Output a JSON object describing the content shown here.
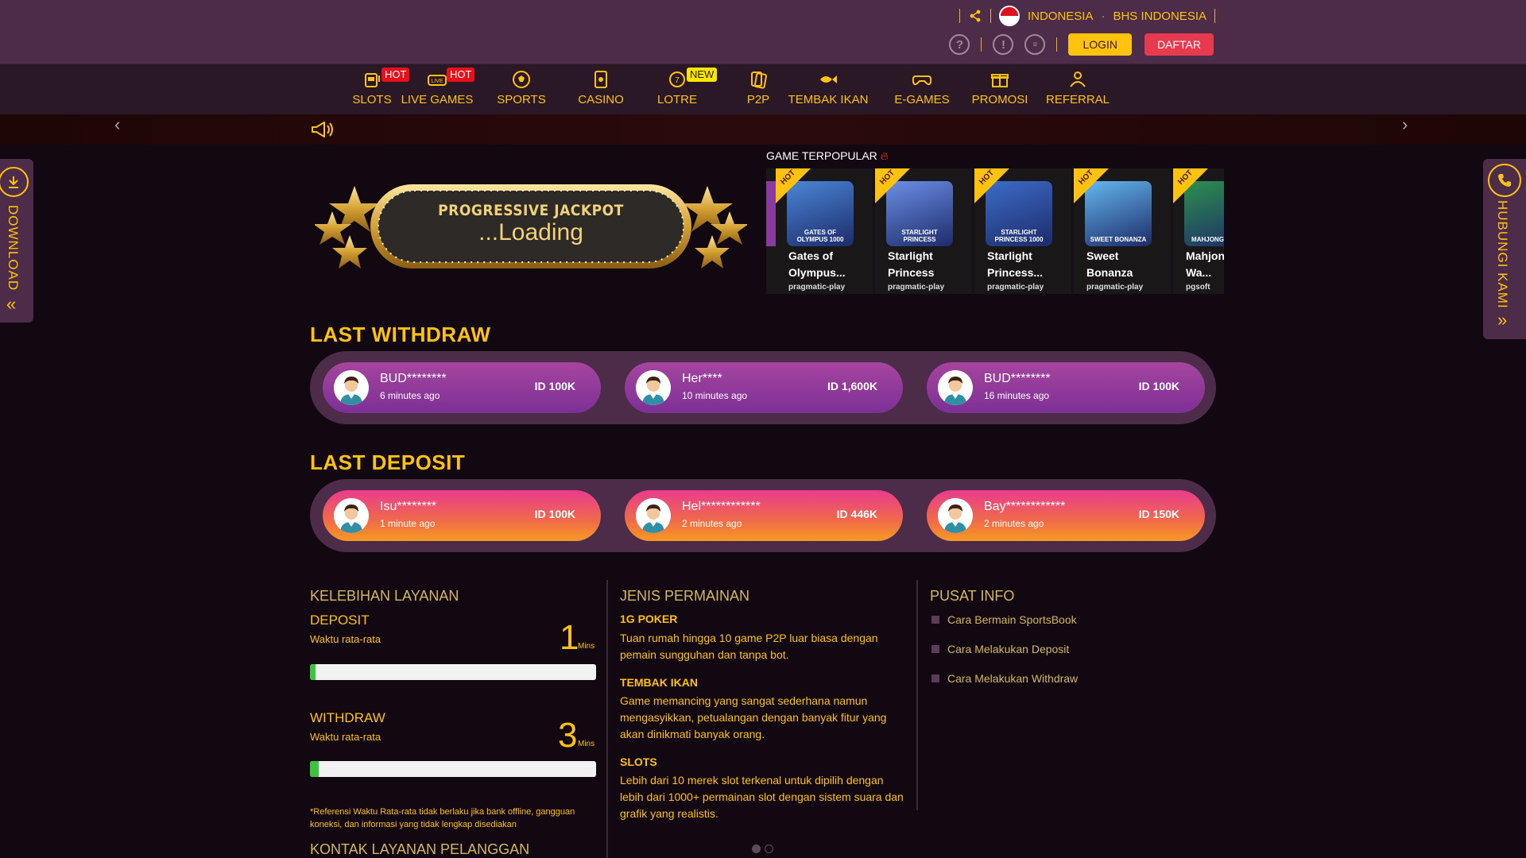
{
  "header": {
    "country": "INDONESIA",
    "language": "BHS INDONESIA",
    "login_label": "LOGIN",
    "register_label": "DAFTAR",
    "help_icon": "?",
    "info_icon": "!"
  },
  "nav": {
    "items": [
      {
        "label": "SLOTS",
        "icon": "slot-machine-icon",
        "badge": "HOT"
      },
      {
        "label": "LIVE GAMES",
        "icon": "live-icon",
        "badge": "HOT"
      },
      {
        "label": "SPORTS",
        "icon": "soccer-ball-icon",
        "badge": ""
      },
      {
        "label": "CASINO",
        "icon": "cards-icon",
        "badge": ""
      },
      {
        "label": "LOTRE",
        "icon": "lottery-icon",
        "badge": "NEW"
      },
      {
        "label": "P2P",
        "icon": "playing-cards-icon",
        "badge": ""
      },
      {
        "label": "TEMBAK IKAN",
        "icon": "fish-icon",
        "badge": ""
      },
      {
        "label": "E-GAMES",
        "icon": "gamepad-icon",
        "badge": ""
      },
      {
        "label": "PROMOSI",
        "icon": "gift-icon",
        "badge": ""
      },
      {
        "label": "REFERRAL",
        "icon": "referral-icon",
        "badge": ""
      }
    ]
  },
  "side": {
    "download_label": "DOWNLOAD",
    "contact_label": "HUBUNGI KAMI"
  },
  "jackpot": {
    "title": "PROGRESSIVE JACKPOT",
    "value": "...Loading"
  },
  "popular": {
    "title": "GAME TERPOPULAR",
    "hot_label": "HOT",
    "games": [
      {
        "name": "Gates of Olympus...",
        "provider": "pragmatic-play",
        "thumb_text": "GATES OF OLYMPUS 1000",
        "color": "#4a86d6"
      },
      {
        "name": "Starlight Princess",
        "provider": "pragmatic-play",
        "thumb_text": "STARLIGHT PRINCESS",
        "color": "#6b8fe6"
      },
      {
        "name": "Starlight Princess...",
        "provider": "pragmatic-play",
        "thumb_text": "STARLIGHT PRINCESS 1000",
        "color": "#3c6cc8"
      },
      {
        "name": "Sweet Bonanza",
        "provider": "pragmatic-play",
        "thumb_text": "SWEET BONANZA",
        "color": "#63b7ee"
      },
      {
        "name": "Mahjong Wa...",
        "provider": "pgsoft",
        "thumb_text": "MAHJONG WAYS",
        "color": "#2d8f4e"
      }
    ]
  },
  "withdraw": {
    "title": "LAST WITHDRAW",
    "items": [
      {
        "name": "BUD********",
        "time": "6 minutes ago",
        "amount": "ID 100K"
      },
      {
        "name": "Her****",
        "time": "10 minutes ago",
        "amount": "ID 1,600K"
      },
      {
        "name": "BUD********",
        "time": "16 minutes ago",
        "amount": "ID 100K"
      }
    ]
  },
  "deposit": {
    "title": "LAST DEPOSIT",
    "items": [
      {
        "name": "Isu********",
        "time": "1 minute ago",
        "amount": "ID 100K"
      },
      {
        "name": "Hel************",
        "time": "2 minutes ago",
        "amount": "ID 446K"
      },
      {
        "name": "Bay************",
        "time": "2 minutes ago",
        "amount": "ID 150K"
      }
    ]
  },
  "service": {
    "title": "KELEBIHAN LAYANAN",
    "deposit_label": "DEPOSIT",
    "deposit_sub": "Waktu rata-rata",
    "deposit_value": "1",
    "deposit_unit": "Mins",
    "deposit_progress": 0.02,
    "withdraw_label": "WITHDRAW",
    "withdraw_sub": "Waktu rata-rata",
    "withdraw_value": "3",
    "withdraw_unit": "Mins",
    "withdraw_progress": 0.03,
    "note": "*Referensi Waktu Rata-rata tidak berlaku jika bank offline, gangguan koneksi, dan informasi yang tidak lengkap disediakan",
    "contact_title": "KONTAK LAYANAN PELANGGAN"
  },
  "game_types": {
    "title": "JENIS PERMAINAN",
    "items": [
      {
        "heading": "1G POKER",
        "text": "Tuan rumah hingga 10 game P2P luar biasa dengan pemain sungguhan dan tanpa bot."
      },
      {
        "heading": "TEMBAK IKAN",
        "text": "Game memancing yang sangat sederhana namun mengasyikkan, petualangan dengan banyak fitur yang akan dinikmati banyak orang."
      },
      {
        "heading": "SLOTS",
        "text": "Lebih dari 10 merek slot terkenal untuk dipilih dengan lebih dari 1000+ permainan slot dengan sistem suara dan grafik yang realistis."
      }
    ]
  },
  "info_center": {
    "title": "PUSAT INFO",
    "links": [
      "Cara Bermain SportsBook",
      "Cara Melakukan Deposit",
      "Cara Melakukan Withdraw"
    ]
  },
  "colors": {
    "accent": "#ffc20e",
    "header_bg": "#4c2c48",
    "body_bg": "#120811",
    "register": "#e83a4f",
    "progress": "#3ec43e"
  }
}
